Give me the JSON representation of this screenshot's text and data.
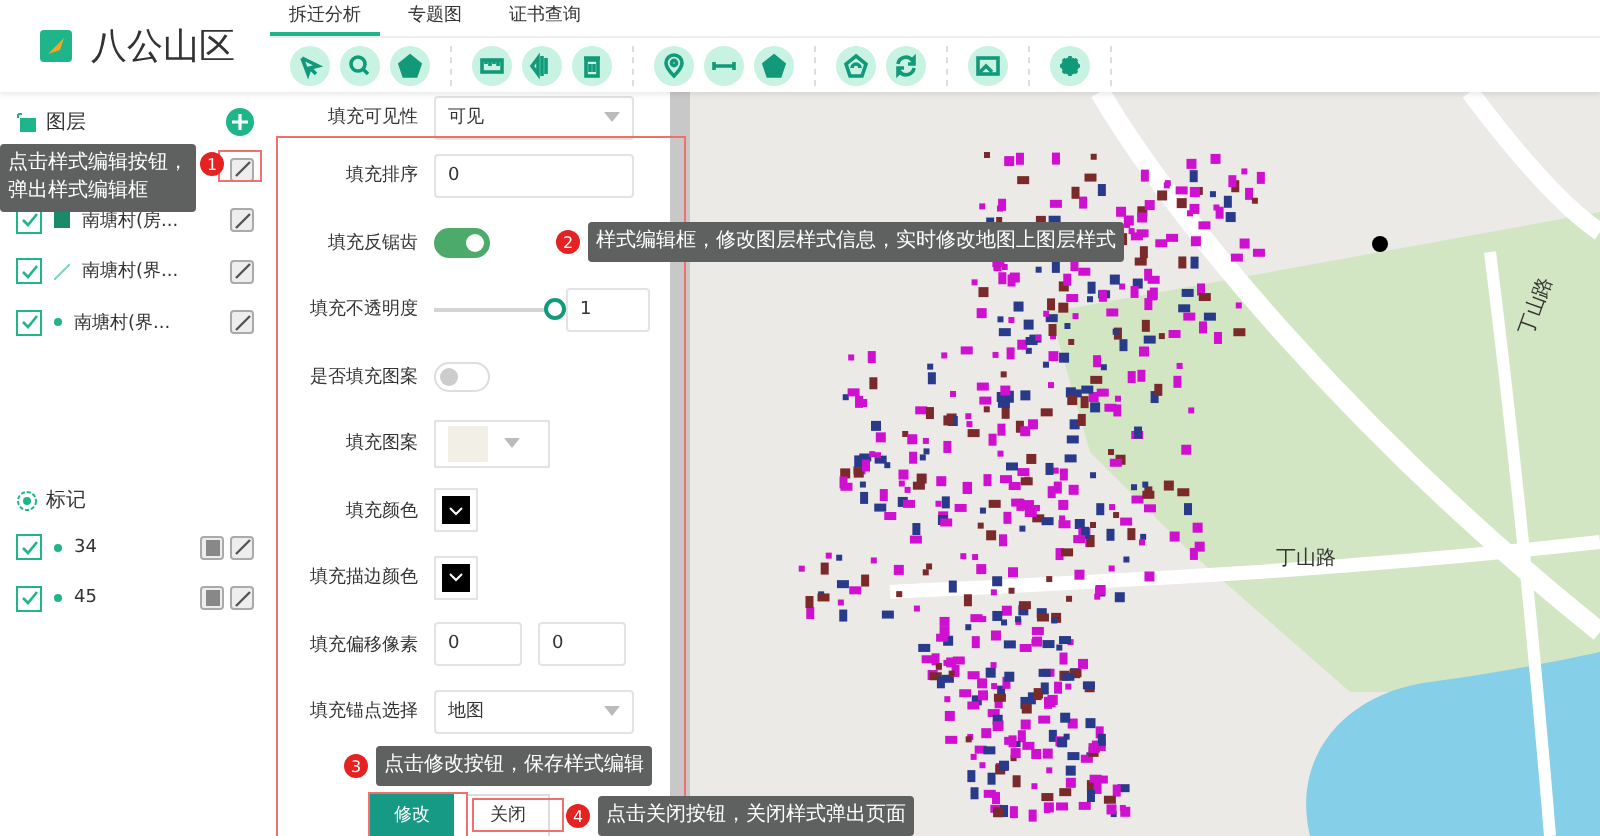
{
  "app": {
    "title": "八公山区"
  },
  "tabs": [
    {
      "label": "拆迁分析",
      "selected": true
    },
    {
      "label": "专题图",
      "selected": false
    },
    {
      "label": "证书查询",
      "selected": false
    }
  ],
  "sidebar": {
    "layers_title": "图层",
    "layers": [
      {
        "kind": "hidden"
      },
      {
        "label": "南塘村(房...",
        "kind": "polygon",
        "checked": true
      },
      {
        "label": "南塘村(界...",
        "kind": "line",
        "checked": true
      },
      {
        "label": "南塘村(界...",
        "kind": "point",
        "checked": true
      }
    ],
    "markers_title": "标记",
    "markers": [
      {
        "label": "34",
        "checked": true
      },
      {
        "label": "45",
        "checked": true
      }
    ]
  },
  "style_form": {
    "rows": [
      {
        "kind": "select",
        "label": "填充可见性",
        "value": "可见"
      },
      {
        "kind": "input",
        "label": "填充排序",
        "value": "0"
      },
      {
        "kind": "toggle",
        "label": "填充反锯齿",
        "on": true
      },
      {
        "kind": "slider",
        "label": "填充不透明度",
        "level": 1,
        "value": "1"
      },
      {
        "kind": "toggle",
        "label": "是否填充图案",
        "on": false
      },
      {
        "kind": "pattern",
        "label": "填充图案"
      },
      {
        "kind": "color",
        "label": "填充颜色",
        "color": "#000000"
      },
      {
        "kind": "color",
        "label": "填充描边颜色",
        "color": "#000000"
      },
      {
        "kind": "pair",
        "label": "填充偏移像素",
        "values": [
          "0",
          "0"
        ]
      },
      {
        "kind": "select",
        "label": "填充锚点选择",
        "value": "地图"
      }
    ],
    "buttons": [
      {
        "label": "修改",
        "kind": "primary"
      },
      {
        "label": "关闭",
        "kind": "plain"
      }
    ]
  },
  "map": {
    "labels": [
      "丁山路",
      "丁山路"
    ]
  },
  "callouts": [
    {
      "number": "1",
      "text": "点击样式编辑按钮，弹出样式编辑框"
    },
    {
      "number": "2",
      "text": "样式编辑框，修改图层样式信息，实时修改地图上图层样式"
    },
    {
      "number": "3",
      "text": "点击修改按钮，保存样式编辑"
    },
    {
      "number": "4",
      "text": "点击关闭按钮，关闭样式弹出页面"
    }
  ]
}
